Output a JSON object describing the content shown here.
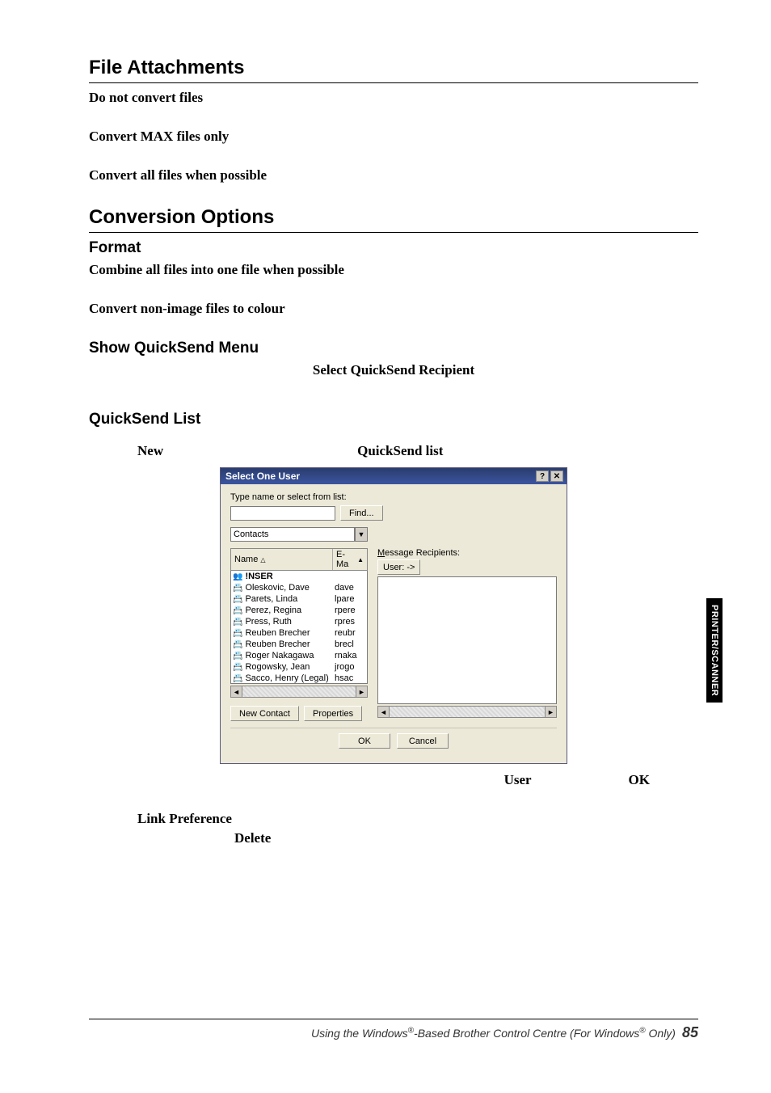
{
  "sections": {
    "file_attachments": {
      "title": "File Attachments",
      "opt1": "Do not convert files",
      "opt2": "Convert MAX files only",
      "opt3": "Convert all files when possible"
    },
    "conversion_options": {
      "title": "Conversion Options",
      "format_heading": "Format",
      "line1": "Combine all files into one file when possible",
      "line2": "Convert non-image files to colour"
    },
    "quicksend": {
      "menu_heading": "Show QuickSend Menu",
      "select_recipient": "Select QuickSend Recipient",
      "list_heading": "QuickSend List",
      "new_label": "New",
      "list_label": "QuickSend list"
    }
  },
  "dialog": {
    "title": "Select One User",
    "type_label": "Type name or select from list:",
    "find_btn": "Find...",
    "combo_value": "Contacts",
    "recipients_label": "Message Recipients:",
    "col_name": "Name",
    "col_email": "E-Ma",
    "user_btn": "User: ->",
    "new_contact_btn": "New Contact",
    "properties_btn": "Properties",
    "ok_btn": "OK",
    "cancel_btn": "Cancel",
    "rows": [
      {
        "name": "!NSER",
        "email": "",
        "icon": "group"
      },
      {
        "name": "Oleskovic, Dave",
        "email": "dave",
        "icon": "card"
      },
      {
        "name": "Parets, Linda",
        "email": "lpare",
        "icon": "card"
      },
      {
        "name": "Perez, Regina",
        "email": "rpere",
        "icon": "card"
      },
      {
        "name": "Press, Ruth",
        "email": "rpres",
        "icon": "card"
      },
      {
        "name": "Reuben Brecher",
        "email": "reubr",
        "icon": "card"
      },
      {
        "name": "Reuben Brecher",
        "email": "brecl",
        "icon": "card"
      },
      {
        "name": "Roger Nakagawa",
        "email": "rnaka",
        "icon": "card"
      },
      {
        "name": "Rogowsky, Jean",
        "email": "jrogo",
        "icon": "card"
      },
      {
        "name": "Sacco, Henry (Legal)",
        "email": "hsac",
        "icon": "card"
      }
    ]
  },
  "after_dialog": {
    "user": "User",
    "ok": "OK"
  },
  "link_pref": {
    "label": "Link Preference",
    "delete": "Delete"
  },
  "side_tab": "PRINTER/SCANNER",
  "footer": {
    "prefix": "Using the Windows",
    "mid": "-Based Brother Control Centre (For Windows",
    "suffix": " Only)",
    "page": "85"
  }
}
